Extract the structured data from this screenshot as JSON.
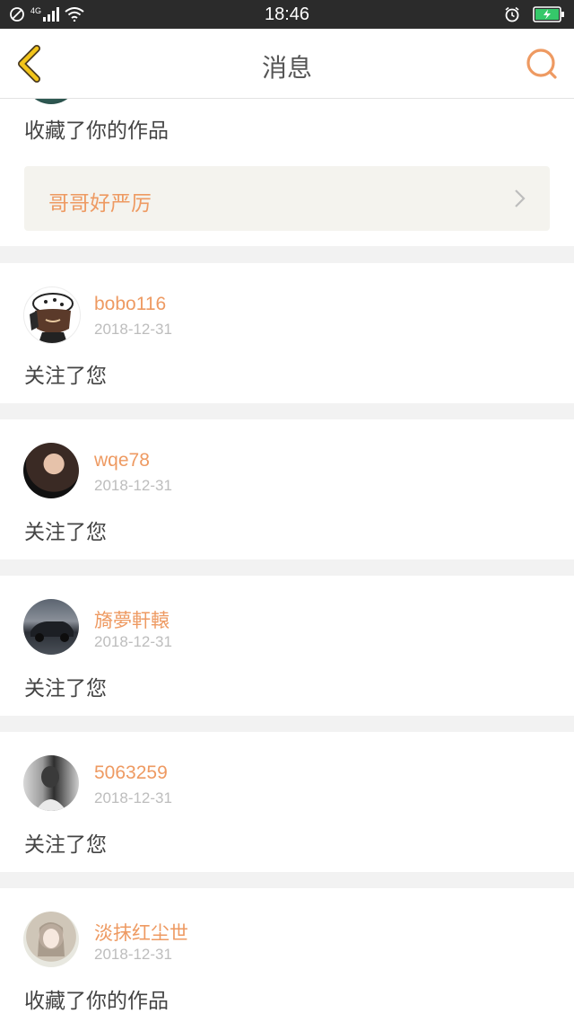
{
  "status_bar": {
    "time": "18:46",
    "network": "4G",
    "icons": [
      "no-disturb-icon",
      "signal-icon",
      "wifi-icon",
      "alarm-icon",
      "battery-charging-icon"
    ]
  },
  "header": {
    "title": "消息",
    "back_icon": "chevron-left-icon",
    "search_icon": "search-icon"
  },
  "colors": {
    "accent": "#ee9a62",
    "back_icon": "#f3c51a",
    "date_text": "#bdbdbd",
    "work_box_bg": "#f4f3ee"
  },
  "messages": [
    {
      "user": "",
      "date": "",
      "action": "收藏了你的作品",
      "work_title": "哥哥好严厉"
    },
    {
      "user": "bobo116",
      "date": "2018-12-31",
      "action": "关注了您"
    },
    {
      "user": "wqe78",
      "date": "2018-12-31",
      "action": "关注了您"
    },
    {
      "user": "旖夢軒轅",
      "date": "2018-12-31",
      "action": "关注了您"
    },
    {
      "user": "5063259",
      "date": "2018-12-31",
      "action": "关注了您"
    },
    {
      "user": "淡抹红尘世",
      "date": "2018-12-31",
      "action": "收藏了你的作品"
    }
  ]
}
